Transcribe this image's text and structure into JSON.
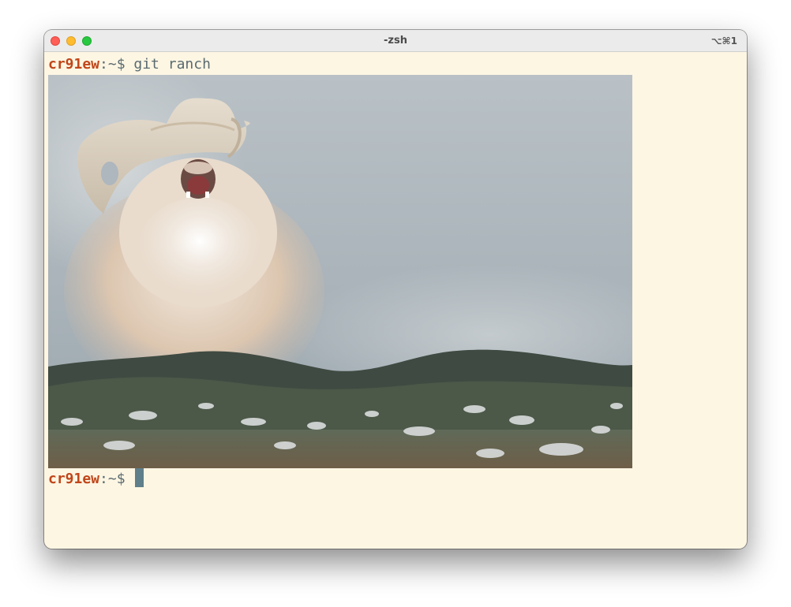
{
  "window": {
    "title": "-zsh",
    "shortcut": "⌥⌘1"
  },
  "terminal": {
    "lines": [
      {
        "host": "cr91ew",
        "path": ":~$",
        "command": " git ranch"
      },
      {
        "host": "cr91ew",
        "path": ":~$",
        "command": " "
      }
    ],
    "image_icon": "cowboy-cat-image"
  },
  "colors": {
    "background": "#fdf6e3",
    "host": "#c0461a",
    "text": "#5a6a70",
    "cursor": "#5f7f8a"
  }
}
